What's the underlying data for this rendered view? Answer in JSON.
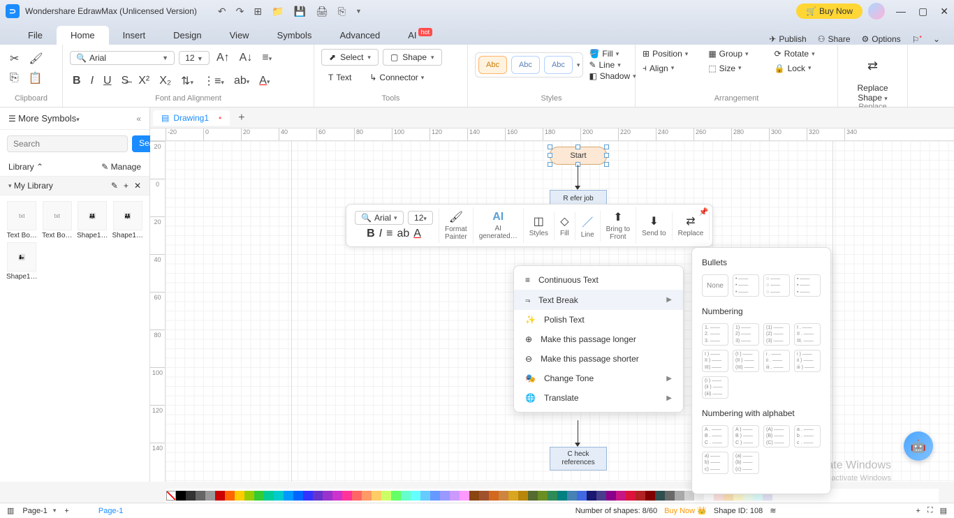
{
  "app": {
    "title": "Wondershare EdrawMax (Unlicensed Version)",
    "buy": "Buy Now"
  },
  "menu": {
    "tabs": [
      "File",
      "Home",
      "Insert",
      "Design",
      "View",
      "Symbols",
      "Advanced",
      "AI"
    ],
    "active": 1,
    "ai_badge": "hot",
    "right": {
      "publish": "Publish",
      "share": "Share",
      "options": "Options"
    }
  },
  "ribbon": {
    "clipboard": {
      "label": "Clipboard"
    },
    "font": {
      "label": "Font and Alignment",
      "family": "Arial",
      "size": "12"
    },
    "tools": {
      "label": "Tools",
      "select": "Select",
      "shape": "Shape",
      "text": "Text",
      "connector": "Connector"
    },
    "styles": {
      "label": "Styles",
      "abc": "Abc",
      "fill": "Fill",
      "line": "Line",
      "shadow": "Shadow"
    },
    "arrange": {
      "label": "Arrangement",
      "position": "Position",
      "align": "Align",
      "group": "Group",
      "size": "Size",
      "rotate": "Rotate",
      "lock": "Lock"
    },
    "replace": {
      "label": "Replace",
      "btn": "Replace\nShape"
    }
  },
  "sidebar": {
    "title": "More Symbols",
    "search_ph": "Search",
    "search_btn": "Search",
    "library": "Library",
    "manage": "Manage",
    "mylib": "My Library",
    "shapes": [
      "Text Bo…",
      "Text Bo…",
      "Shape1…",
      "Shape1…",
      "Shape1…"
    ]
  },
  "doc": {
    "tab": "Drawing1"
  },
  "ruler_h": [
    "-20",
    "0",
    "20",
    "40",
    "60",
    "80",
    "100",
    "120",
    "140",
    "160",
    "180",
    "200",
    "220",
    "240",
    "260",
    "280",
    "300",
    "320",
    "340"
  ],
  "ruler_v": [
    "20",
    "0",
    "20",
    "40",
    "60",
    "80",
    "100",
    "120",
    "140"
  ],
  "canvas": {
    "start": "Start",
    "process2": "C heck\nreferences"
  },
  "float": {
    "font": "Arial",
    "size": "12",
    "format_painter": "Format\nPainter",
    "ai": "AI\ngenerated…",
    "styles": "Styles",
    "fill": "Fill",
    "line": "Line",
    "bring": "Bring to\nFront",
    "send": "Send to",
    "replace": "Replace"
  },
  "ctx": {
    "items": [
      "Continuous Text",
      "Text Break",
      "Polish Text",
      "Make this passage longer",
      "Make this passage shorter",
      "Change Tone",
      "Translate"
    ],
    "hover": 1
  },
  "submenu": {
    "bullets_title": "Bullets",
    "none": "None",
    "numbering_title": "Numbering",
    "alpha_title": "Numbering with alphabet",
    "num_opts": [
      [
        "1.",
        "2.",
        "3."
      ],
      [
        "1)",
        "2)",
        "3)"
      ],
      [
        "(1)",
        "(2)",
        "(3)"
      ],
      [
        "I .",
        "II .",
        "III."
      ],
      [
        "I )",
        "II )",
        "III)"
      ],
      [
        "(I )",
        "(II )",
        "(III)"
      ],
      [
        "i .",
        "ii .",
        "iii ."
      ],
      [
        "i )",
        "ii )",
        "iii )"
      ],
      [
        "(i )",
        "(ii )",
        "(iii)"
      ]
    ],
    "alpha_opts": [
      [
        "A .",
        "B .",
        "C ."
      ],
      [
        "A )",
        "B )",
        "C )"
      ],
      [
        "(A)",
        "(B)",
        "(C)"
      ],
      [
        "a .",
        "b .",
        "c ."
      ],
      [
        "a)",
        "b)",
        "c)"
      ],
      [
        "(a)",
        "(b)",
        "(c)"
      ]
    ]
  },
  "colors": [
    "#000000",
    "#333333",
    "#666666",
    "#999999",
    "#cc0000",
    "#ff6600",
    "#ffcc00",
    "#99cc00",
    "#33cc33",
    "#00cc99",
    "#00cccc",
    "#0099ff",
    "#0066ff",
    "#3333ff",
    "#6633cc",
    "#9933cc",
    "#cc33cc",
    "#ff3399",
    "#ff6666",
    "#ff9966",
    "#ffcc66",
    "#ccff66",
    "#66ff66",
    "#66ffcc",
    "#66ffff",
    "#66ccff",
    "#6699ff",
    "#9999ff",
    "#cc99ff",
    "#ff99ff",
    "#8b4513",
    "#a0522d",
    "#d2691e",
    "#cd853f",
    "#daa520",
    "#b8860b",
    "#556b2f",
    "#6b8e23",
    "#2e8b57",
    "#008080",
    "#4682b4",
    "#4169e1",
    "#191970",
    "#483d8b",
    "#8b008b",
    "#c71585",
    "#dc143c",
    "#b22222",
    "#800000",
    "#2f4f4f",
    "#696969",
    "#a9a9a9",
    "#d3d3d3",
    "#f5f5f5",
    "#ffffff",
    "#ffe4e1",
    "#ffe4b5",
    "#fffacd",
    "#f0fff0",
    "#e0ffff",
    "#e6e6fa"
  ],
  "status": {
    "page_sel": "Page-1",
    "page_tab": "Page-1",
    "shapes": "Number of shapes: 8/60",
    "buy": "Buy Now",
    "shape_id": "Shape ID: 108"
  },
  "watermark": {
    "l1": "Activate Windows",
    "l2": "Go to Settings to activate Windows"
  }
}
